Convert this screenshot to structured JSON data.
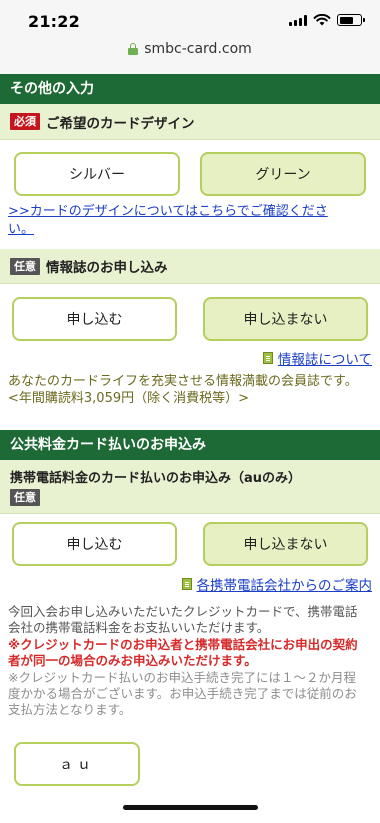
{
  "status": {
    "time": "21:22"
  },
  "browser": {
    "url": "smbc-card.com"
  },
  "section_other": {
    "title": "その他の入力"
  },
  "card_design": {
    "required_badge": "必須",
    "label": "ご希望のカードデザイン",
    "options": [
      "シルバー",
      "グリーン"
    ],
    "selected": "グリーン",
    "link_text": ">>カードのデザインについてはこちらでご確認くださ い。"
  },
  "magazine": {
    "optional_badge": "任意",
    "label": "情報誌のお申し込み",
    "options": [
      "申し込む",
      "申し込まない"
    ],
    "selected": "申し込まない",
    "link_text": "情報誌について",
    "description": "あなたのカードライフを充実させる情報満載の会員誌です。",
    "price": "<年間購読料3,059円（除く消費税等）>"
  },
  "section_utility": {
    "title": "公共料金カード払いのお申込み"
  },
  "mobile": {
    "label": "携帯電話料金のカード払いのお申込み（auのみ）",
    "optional_badge": "任意",
    "options": [
      "申し込む",
      "申し込まない"
    ],
    "selected": "申し込まない",
    "link_text": "各携帯電話会社からのご案内",
    "note_gray": "今回入会お申し込みいただいたクレジットカードで、携帯電話会社の携帯電話料金をお支払いいただけます。",
    "note_red": "※クレジットカードのお申込者と携帯電話会社にお申出の契約者が同一の場合のみお申込みいただけます。",
    "note_light": "※クレジットカード払いのお申込手続き完了には１～２か月程度かかる場合がございます。お申込手続き完了までは従前のお支払方法となります。",
    "carrier_option": "ａｕ"
  }
}
